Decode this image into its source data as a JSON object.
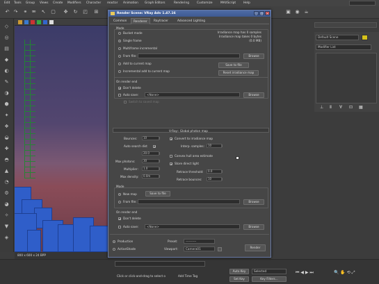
{
  "menu": [
    "Edit",
    "Tools",
    "Group",
    "Views",
    "Create",
    "Modifiers",
    "Character",
    "reactor",
    "Animation",
    "Graph Editors",
    "Rendering",
    "Customize",
    "MAXScript",
    "Help"
  ],
  "dialog": {
    "title": "Render Scene: VRay Adv 1.47.16",
    "tabs": [
      "Common",
      "Renderer",
      "Raytracer",
      "Advanced Lighting"
    ],
    "mode_label": "Mode",
    "modes": [
      "Bucket mode",
      "Single frame",
      "Multiframe incremental",
      "From file:",
      "Add to current map",
      "Incremental add to current map"
    ],
    "mode_selected": "Single frame",
    "irradiance_info": [
      "Irradiance map has 0 samples",
      "Irradiance map takes 0 bytes",
      "(0.0 MB)"
    ],
    "browse1": "Browse",
    "save_to_file": "Save to file",
    "reset_map": "Reset irradiance map",
    "on_render_end": "On render end",
    "dont_delete": "Don't delete",
    "auto_save": "Auto save:",
    "auto_save_value": "<None>",
    "browse2": "Browse",
    "switch_saved": "Switch to saved map",
    "rollout_title": "V-Ray:: Global photon map",
    "bounces_label": "Bounces:",
    "bounces": "10",
    "auto_search": "Auto search dist",
    "search_dist": "20.0",
    "max_photons_label": "Max photons:",
    "max_photons": "30",
    "multiplier_label": "Multiplier:",
    "multiplier": "1.0",
    "max_density_label": "Max density:",
    "max_density": "0.0m",
    "convert_irr": "Convert to irradiance map",
    "interp_samples_label": "Interp. samples:",
    "interp_samples": "10",
    "convex_hull": "Convex hull area estimate",
    "store_direct": "Store direct light",
    "retrace_thr_label": "Retrace threshold:",
    "retrace_thr": "0.0",
    "retrace_bounces_label": "Retrace bounces:",
    "retrace_bounces": "10",
    "mode2_label": "Mode",
    "new_map": "New map",
    "save_to_file2": "Save to file",
    "from_file": "From file:",
    "browse3": "Browse",
    "on_render_end2": "On render end",
    "dont_delete2": "Don't delete",
    "auto_save2": "Auto save:",
    "auto_save2_value": "<None>",
    "browse4": "Browse",
    "production": "Production",
    "activeshade": "ActiveShade",
    "preset_label": "Preset:",
    "preset_value": "----------",
    "viewport_label": "Viewport:",
    "viewport_value": "Camera01",
    "render_btn": "Render"
  },
  "viewport": {
    "status": "800 x 600 x 24 BPP"
  },
  "right_panel": {
    "name_field": "Default Scene",
    "modifier_list": "Modifier List"
  },
  "bottom": {
    "prompt": "Click or click-and-drag to select o",
    "add_time_tag": "Add Time Tag",
    "auto_key": "Auto Key",
    "selected": "Selected",
    "set_key": "Set Key",
    "key_filters": "Key Filters..."
  }
}
